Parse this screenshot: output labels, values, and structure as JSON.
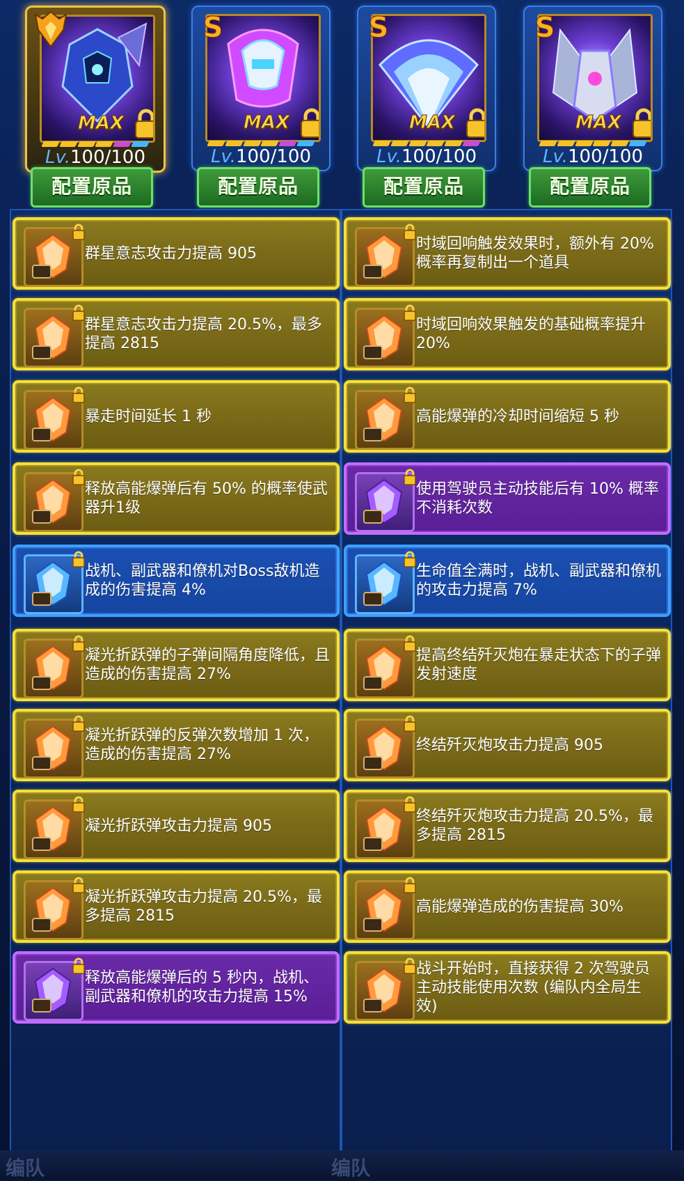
{
  "cards": [
    {
      "level_prefix": "Lv.",
      "level": "100/100",
      "max_label": "MAX",
      "rank": "crest",
      "button": "配置原品"
    },
    {
      "level_prefix": "Lv.",
      "level": "100/100",
      "max_label": "MAX",
      "rank": "S",
      "button": "配置原品"
    },
    {
      "level_prefix": "Lv.",
      "level": "100/100",
      "max_label": "MAX",
      "rank": "S",
      "button": "配置原品"
    },
    {
      "level_prefix": "Lv.",
      "level": "100/100",
      "max_label": "MAX",
      "rank": "S",
      "button": "配置原品"
    }
  ],
  "left_perks": [
    {
      "tier": "gold",
      "text": "群星意志攻击力提高 905"
    },
    {
      "tier": "gold",
      "text": "群星意志攻击力提高 20.5%，最多提高 2815"
    },
    {
      "tier": "gold",
      "text": "暴走时间延长 1 秒"
    },
    {
      "tier": "gold",
      "text": "释放高能爆弹后有 50% 的概率使武器升1级"
    },
    {
      "tier": "blue",
      "text": "战机、副武器和僚机对Boss敌机造成的伤害提高 4%"
    },
    {
      "tier": "gold",
      "text": "凝光折跃弹的子弹间隔角度降低，且造成的伤害提高 27%"
    },
    {
      "tier": "gold",
      "text": "凝光折跃弹的反弹次数增加 1 次，造成的伤害提高 27%"
    },
    {
      "tier": "gold",
      "text": "凝光折跃弹攻击力提高 905"
    },
    {
      "tier": "gold",
      "text": "凝光折跃弹攻击力提高 20.5%，最多提高 2815"
    },
    {
      "tier": "purple",
      "text": "释放高能爆弹后的 5 秒内，战机、副武器和僚机的攻击力提高 15%"
    }
  ],
  "right_perks": [
    {
      "tier": "gold",
      "text": "时域回响触发效果时，额外有 20% 概率再复制出一个道具"
    },
    {
      "tier": "gold",
      "text": "时域回响效果触发的基础概率提升 20%"
    },
    {
      "tier": "gold",
      "text": "高能爆弹的冷却时间缩短 5 秒"
    },
    {
      "tier": "purple",
      "text": "使用驾驶员主动技能后有 10% 概率不消耗次数"
    },
    {
      "tier": "blue",
      "text": "生命值全满时，战机、副武器和僚机的攻击力提高 7%"
    },
    {
      "tier": "gold",
      "text": "提高终结歼灭炮在暴走状态下的子弹发射速度"
    },
    {
      "tier": "gold",
      "text": "终结歼灭炮攻击力提高 905"
    },
    {
      "tier": "gold",
      "text": "终结歼灭炮攻击力提高 20.5%，最多提高 2815"
    },
    {
      "tier": "gold",
      "text": "高能爆弹造成的伤害提高 30%"
    },
    {
      "tier": "gold",
      "text": "战斗开始时，直接获得 2 次驾驶员主动技能使用次数 (编队内全局生效)"
    }
  ],
  "footer": {
    "left": "编队",
    "right": "编队"
  },
  "colors": {
    "gold_border": "#f4e03a",
    "purple_border": "#c36cff",
    "blue_border": "#3ca0ff",
    "button_green": "#3f9a3a"
  }
}
